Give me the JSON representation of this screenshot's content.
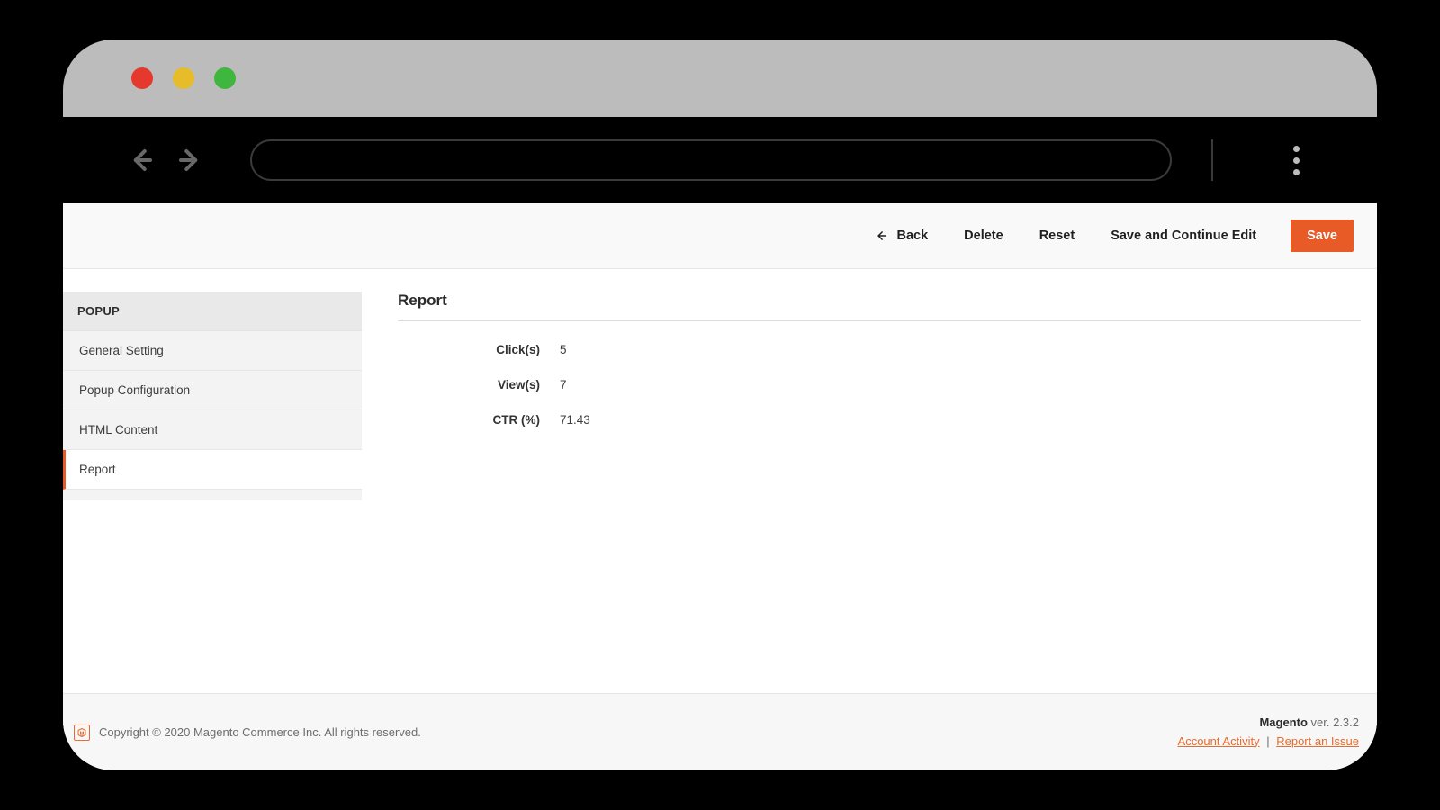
{
  "actionBar": {
    "back": "Back",
    "delete": "Delete",
    "reset": "Reset",
    "saveContinue": "Save and Continue Edit",
    "save": "Save"
  },
  "sidebar": {
    "heading": "POPUP",
    "items": [
      {
        "label": "General Setting"
      },
      {
        "label": "Popup Configuration"
      },
      {
        "label": "HTML Content"
      },
      {
        "label": "Report"
      }
    ]
  },
  "report": {
    "title": "Report",
    "rows": {
      "clicks": {
        "label": "Click(s)",
        "value": "5"
      },
      "views": {
        "label": "View(s)",
        "value": "7"
      },
      "ctr": {
        "label": "CTR (%)",
        "value": "71.43"
      }
    }
  },
  "footer": {
    "copyright": "Copyright © 2020 Magento Commerce Inc. All rights reserved.",
    "brand": "Magento",
    "version": " ver. 2.3.2",
    "accountActivity": "Account Activity",
    "reportIssue": "Report an Issue"
  }
}
